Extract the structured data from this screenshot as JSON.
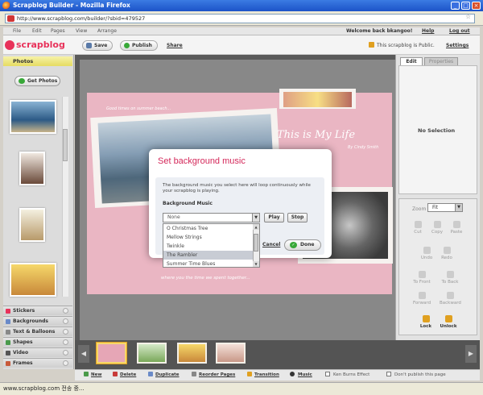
{
  "window": {
    "title": "Scrapblog Builder - Mozilla Firefox",
    "url": "http://www.scrapblog.com/builder/?sbid=479527",
    "status": "www.scrapblog.com 전송 중..."
  },
  "menu": {
    "items": [
      "File",
      "Edit",
      "Pages",
      "View",
      "Arrange"
    ],
    "welcome": "Welcome back bkangoo!",
    "help": "Help",
    "logout": "Log out"
  },
  "toolbar": {
    "logo": "scrapblog",
    "save": "Save",
    "publish": "Publish",
    "share": "Share",
    "public_status": "This scrapblog is Public.",
    "settings": "Settings"
  },
  "left_panel": {
    "photos_header": "Photos",
    "get_photos": "Get Photos",
    "sections": [
      "Stickers",
      "Backgrounds",
      "Text & Balloons",
      "Shapes",
      "Video",
      "Frames"
    ]
  },
  "canvas": {
    "title": "This is My Life",
    "subtitle": "By Cindy Smith",
    "caption_top": "Good times on summer beach...",
    "caption_bottom": "where you the time we spent together..."
  },
  "right_panel": {
    "tabs": [
      "Edit",
      "Properties"
    ],
    "no_selection": "No Selection",
    "zoom_label": "Zoom",
    "zoom_value": "Fit",
    "tools": [
      "Cut",
      "Copy",
      "Paste",
      "Undo",
      "Redo",
      "To Front",
      "To Back",
      "Forward",
      "Backward",
      "Lock",
      "Unlock"
    ]
  },
  "bottom_bar": {
    "new": "New",
    "delete": "Delete",
    "duplicate": "Duplicate",
    "reorder": "Reorder Pages",
    "transition": "Transition",
    "music": "Music",
    "ken_burns": "Ken Burns Effect",
    "dont_publish": "Don't publish this page"
  },
  "dialog": {
    "title": "Set background music",
    "description": "The background music you select here will loop continuously while your scrapblog is playing.",
    "label": "Background Music",
    "selected": "None",
    "options": [
      "O Christmas Tree",
      "Mellow Strings",
      "Twinkle",
      "The Rambler",
      "Summer Time Blues"
    ],
    "highlighted_index": 3,
    "play": "Play",
    "stop": "Stop",
    "cancel": "Cancel",
    "done": "Done"
  },
  "colors": {
    "brand": "#e8325a",
    "dialog_title": "#d4285a",
    "canvas_bg": "#e6a6b6"
  }
}
